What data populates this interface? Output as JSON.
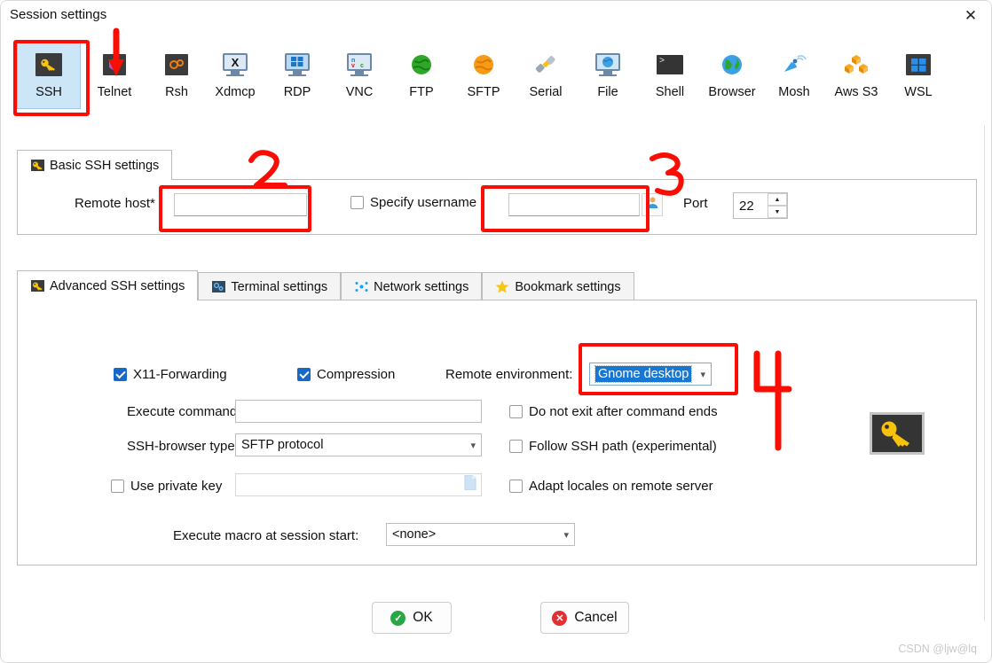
{
  "window": {
    "title": "Session settings",
    "close_label": "✕"
  },
  "toolbar": {
    "items": [
      {
        "label": "SSH",
        "icon": "key-icon",
        "selected": true
      },
      {
        "label": "Telnet",
        "icon": "cube-icon",
        "selected": false
      },
      {
        "label": "Rsh",
        "icon": "gears-icon",
        "selected": false
      },
      {
        "label": "Xdmcp",
        "icon": "x-monitor-icon",
        "selected": false
      },
      {
        "label": "RDP",
        "icon": "windows-monitor-icon",
        "selected": false
      },
      {
        "label": "VNC",
        "icon": "vnc-monitor-icon",
        "selected": false
      },
      {
        "label": "FTP",
        "icon": "green-globe-icon",
        "selected": false
      },
      {
        "label": "SFTP",
        "icon": "orange-globe-icon",
        "selected": false
      },
      {
        "label": "Serial",
        "icon": "plug-icon",
        "selected": false
      },
      {
        "label": "File",
        "icon": "file-monitor-icon",
        "selected": false
      },
      {
        "label": "Shell",
        "icon": "terminal-icon",
        "selected": false
      },
      {
        "label": "Browser",
        "icon": "globe-icon",
        "selected": false
      },
      {
        "label": "Mosh",
        "icon": "satellite-icon",
        "selected": false
      },
      {
        "label": "Aws S3",
        "icon": "aws-cubes-icon",
        "selected": false
      },
      {
        "label": "WSL",
        "icon": "windows-icon",
        "selected": false
      }
    ]
  },
  "basic": {
    "tab_label": "Basic SSH settings",
    "tab_icon": "key-icon",
    "remote_host_label": "Remote host",
    "remote_host_required": "*",
    "remote_host_value": "",
    "specify_username_label": "Specify username",
    "specify_username_checked": false,
    "username_value": "",
    "username_picker_icon": "user-icon",
    "port_label": "Port",
    "port_value": "22",
    "spinner_up": "▲",
    "spinner_down": "▼"
  },
  "advanced": {
    "tabs": [
      {
        "label": "Advanced SSH settings",
        "icon": "key-icon",
        "active": true
      },
      {
        "label": "Terminal settings",
        "icon": "terminal-settings-icon",
        "active": false
      },
      {
        "label": "Network settings",
        "icon": "network-icon",
        "active": false
      },
      {
        "label": "Bookmark settings",
        "icon": "star-icon",
        "active": false
      }
    ],
    "x11_forwarding_label": "X11-Forwarding",
    "x11_forwarding_checked": true,
    "compression_label": "Compression",
    "compression_checked": true,
    "remote_environment_label": "Remote environment:",
    "remote_environment_value": "Gnome desktop",
    "execute_command_label": "Execute command:",
    "execute_command_value": "",
    "ssh_browser_type_label": "SSH-browser type:",
    "ssh_browser_type_value": "SFTP protocol",
    "use_private_key_label": "Use private key",
    "use_private_key_checked": false,
    "private_key_value": "",
    "private_key_browse_icon": "document-icon",
    "do_not_exit_label": "Do not exit after command ends",
    "do_not_exit_checked": false,
    "follow_ssh_path_label": "Follow SSH path (experimental)",
    "follow_ssh_path_checked": false,
    "adapt_locales_label": "Adapt locales on remote server",
    "adapt_locales_checked": false,
    "execute_macro_label": "Execute macro at session start:",
    "execute_macro_value": "<none>",
    "side_icon": "key-icon"
  },
  "footer": {
    "ok_label": "OK",
    "cancel_label": "Cancel",
    "ok_icon": "check-circle-icon",
    "cancel_icon": "x-circle-icon",
    "watermark": "CSDN @ljw@lq"
  },
  "annotations": {
    "arrow_1": "red-arrow-to-ssh",
    "mark_2": "2",
    "mark_3": "3",
    "mark_4": "4"
  },
  "colors": {
    "accent_red": "#fb0d03",
    "checkbox_blue": "#1769c7",
    "selection_blue": "#1877d2",
    "selected_tile": "#cde6f7"
  }
}
